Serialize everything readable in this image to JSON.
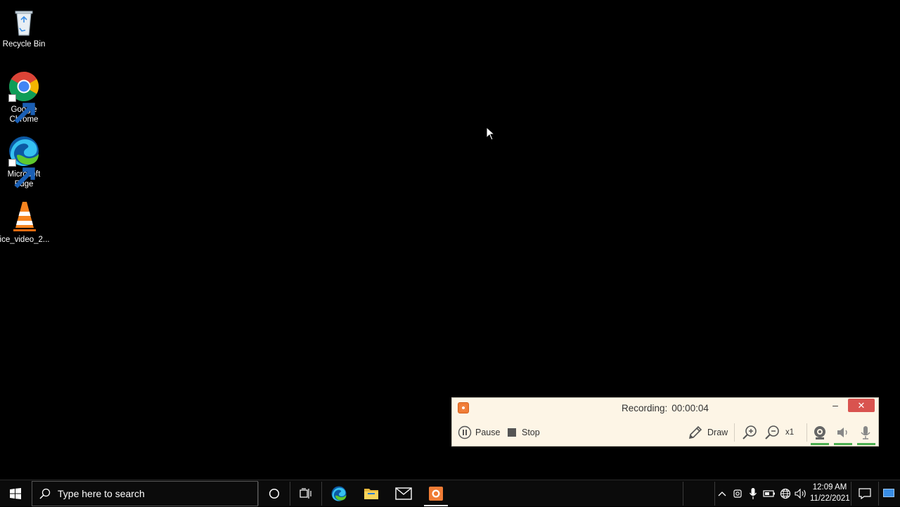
{
  "desktop": {
    "icons": [
      {
        "label": "Recycle Bin",
        "icon": "recycle-bin-icon"
      },
      {
        "label": "Google Chrome",
        "icon": "chrome-icon"
      },
      {
        "label": "Microsoft Edge",
        "icon": "edge-icon"
      },
      {
        "label": "ice_video_2...",
        "icon": "vlc-icon"
      }
    ]
  },
  "recorder": {
    "status_label": "Recording:",
    "elapsed": "00:00:04",
    "minimize_glyph": "–",
    "close_glyph": "✕",
    "pause_label": "Pause",
    "stop_label": "Stop",
    "draw_label": "Draw",
    "zoom_level": "x1",
    "accent_color": "#f07c35"
  },
  "taskbar": {
    "search_placeholder": "Type here to search",
    "clock_time": "12:09 AM",
    "clock_date": "11/22/2021",
    "pinned": [
      "cortana-icon",
      "task-view-icon",
      "edge-icon",
      "file-explorer-icon",
      "mail-icon",
      "recorder-icon"
    ],
    "tray": [
      "chevron-up-icon",
      "camera-icon",
      "microphone-icon",
      "battery-icon",
      "network-icon",
      "volume-icon",
      "notification-icon"
    ]
  }
}
